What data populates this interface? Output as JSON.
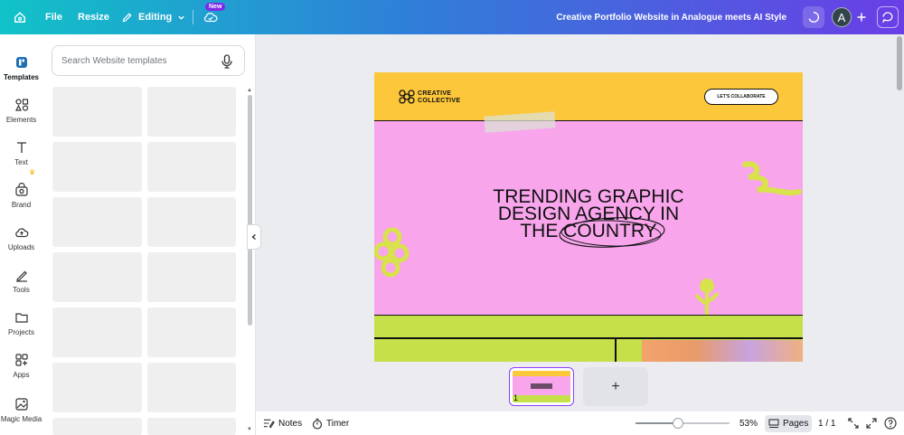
{
  "topbar": {
    "file": "File",
    "resize": "Resize",
    "editing": "Editing",
    "new_badge": "New",
    "doc_title": "Creative Portfolio Website in Analogue meets AI  Style",
    "avatar_initial": "A"
  },
  "rail": {
    "items": [
      {
        "label": "Templates",
        "icon": "templates-icon"
      },
      {
        "label": "Elements",
        "icon": "elements-icon"
      },
      {
        "label": "Text",
        "icon": "text-icon"
      },
      {
        "label": "Brand",
        "icon": "brand-icon"
      },
      {
        "label": "Uploads",
        "icon": "uploads-icon"
      },
      {
        "label": "Tools",
        "icon": "tools-icon"
      },
      {
        "label": "Projects",
        "icon": "projects-icon"
      },
      {
        "label": "Apps",
        "icon": "apps-icon"
      },
      {
        "label": "Magic Media",
        "icon": "magic-media-icon"
      }
    ]
  },
  "panel": {
    "search_placeholder": "Search Website templates"
  },
  "design": {
    "logo_line1": "CREATIVE",
    "logo_line2": "COLLECTIVE",
    "cta": "LET'S COLLABORATE",
    "headline_line1": "TRENDING GRAPHIC",
    "headline_line2": "DESIGN AGENCY IN",
    "headline_line3": "THE COUNTRY"
  },
  "pages": {
    "current_page_number": "1",
    "add_symbol": "+"
  },
  "bottombar": {
    "notes": "Notes",
    "timer": "Timer",
    "zoom": "53%",
    "zoom_level": 0.45,
    "pages_label": "Pages",
    "page_count": "1 / 1"
  },
  "colors": {
    "accent": "#8b3dff",
    "header_yellow": "#fcc73a",
    "canvas_pink": "#f8a5ec",
    "band_green": "#c6e04a"
  }
}
